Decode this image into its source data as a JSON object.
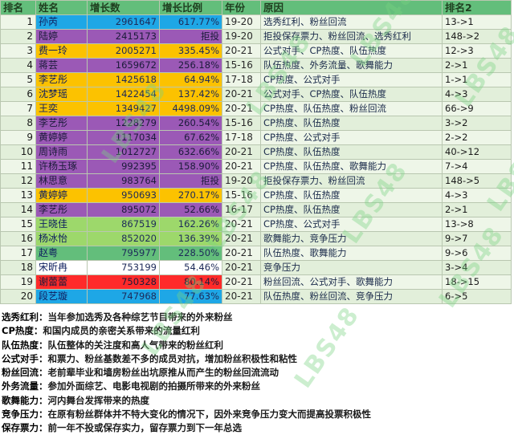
{
  "headers": {
    "rank": "排名",
    "name": "姓名",
    "growth": "增长数",
    "ratio": "增长比例",
    "year": "年份",
    "reason": "原因",
    "rank2": "排名2"
  },
  "rows": [
    {
      "rank": "1",
      "name": "孙芮",
      "growth": "2961647",
      "ratio": "617.77%",
      "year": "19-20",
      "reason": "选秀红利、粉丝回流",
      "rank2": "13->1",
      "color": "#1ea7e6"
    },
    {
      "rank": "2",
      "name": "陆婷",
      "growth": "2415173",
      "ratio": "拒投",
      "year": "19-20",
      "reason": "拒投保存票力、粉丝回流、选秀红利",
      "rank2": "148->2",
      "color": "#9b59b6"
    },
    {
      "rank": "3",
      "name": "费一玲",
      "growth": "2005271",
      "ratio": "335.45%",
      "year": "20-21",
      "reason": "公式对手、CP热度、队伍热度",
      "rank2": "12->3",
      "color": "#fcc200"
    },
    {
      "rank": "4",
      "name": "蒋芸",
      "growth": "1659672",
      "ratio": "256.18%",
      "year": "15-16",
      "reason": "队伍热度、外务流量、歌舞能力",
      "rank2": "2->1",
      "color": "#9b59b6"
    },
    {
      "rank": "5",
      "name": "李艺彤",
      "growth": "1425618",
      "ratio": "64.94%",
      "year": "17-18",
      "reason": "CP热度、公式对手",
      "rank2": "1->1",
      "color": "#fcc200"
    },
    {
      "rank": "6",
      "name": "沈梦瑶",
      "growth": "1422454",
      "ratio": "137.42%",
      "year": "20-21",
      "reason": "公式对手、CP热度、队伍热度",
      "rank2": "4->3",
      "color": "#fcc200"
    },
    {
      "rank": "7",
      "name": "王奕",
      "growth": "1349427",
      "ratio": "4498.09%",
      "year": "20-21",
      "reason": "CP热度、队伍热度、粉丝回流",
      "rank2": "66->9",
      "color": "#fcc200"
    },
    {
      "rank": "8",
      "name": "李艺彤",
      "growth": "1228279",
      "ratio": "260.54%",
      "year": "15-16",
      "reason": "CP热度、队伍热度",
      "rank2": "3->2",
      "color": "#9b59b6"
    },
    {
      "rank": "9",
      "name": "黄婷婷",
      "growth": "1117034",
      "ratio": "67.62%",
      "year": "17-18",
      "reason": "CP热度、公式对手",
      "rank2": "2->2",
      "color": "#9b59b6"
    },
    {
      "rank": "10",
      "name": "周诗雨",
      "growth": "1012727",
      "ratio": "632.66%",
      "year": "20-21",
      "reason": "CP热度、队伍热度",
      "rank2": "40->12",
      "color": "#9b59b6"
    },
    {
      "rank": "11",
      "name": "许杨玉琢",
      "growth": "992395",
      "ratio": "158.90%",
      "year": "20-21",
      "reason": "CP热度、队伍热度、歌舞能力",
      "rank2": "7->4",
      "color": "#9b59b6"
    },
    {
      "rank": "12",
      "name": "林思意",
      "growth": "983764",
      "ratio": "拒投",
      "year": "19-20",
      "reason": "拒投保存票力、粉丝回流",
      "rank2": "148->5",
      "color": "#9b59b6"
    },
    {
      "rank": "13",
      "name": "黄婷婷",
      "growth": "950693",
      "ratio": "270.17%",
      "year": "15-16",
      "reason": "CP热度、队伍热度",
      "rank2": "4->3",
      "color": "#fcc200"
    },
    {
      "rank": "14",
      "name": "李艺彤",
      "growth": "895072",
      "ratio": "52.66%",
      "year": "16-17",
      "reason": "CP热度、队伍热度",
      "rank2": "2->1",
      "color": "#9b59b6"
    },
    {
      "rank": "15",
      "name": "王晓佳",
      "growth": "867519",
      "ratio": "162.26%",
      "year": "20-21",
      "reason": "CP热度、公式对手",
      "rank2": "13->8",
      "color": "#9dd86b"
    },
    {
      "rank": "16",
      "name": "杨冰怡",
      "growth": "852020",
      "ratio": "136.39%",
      "year": "20-21",
      "reason": "歌舞能力、竞争压力",
      "rank2": "9->7",
      "color": "#9dd86b"
    },
    {
      "rank": "17",
      "name": "赵粤",
      "growth": "795977",
      "ratio": "228.50%",
      "year": "20-21",
      "reason": "队伍热度、歌舞能力",
      "rank2": "9->6",
      "color": "#63be7b"
    },
    {
      "rank": "18",
      "name": "宋昕冉",
      "growth": "753199",
      "ratio": "54.46%",
      "year": "20-21",
      "reason": "竞争压力",
      "rank2": "3->4",
      "color": "#ffffff"
    },
    {
      "rank": "19",
      "name": "谢蕾蕾",
      "growth": "750328",
      "ratio": "80.14%",
      "year": "20-21",
      "reason": "粉丝回流、公式对手、歌舞能力",
      "rank2": "18->15",
      "color": "#ff2a2a"
    },
    {
      "rank": "20",
      "name": "段艺璇",
      "growth": "747968",
      "ratio": "77.63%",
      "year": "20-21",
      "reason": "队伍热度、粉丝回流、竞争压力",
      "rank2": "6->5",
      "color": "#1ea7e6"
    }
  ],
  "notes": [
    {
      "term": "选秀红利：",
      "def": "当年参加选秀及各种综艺节目带来的外来粉丝"
    },
    {
      "term": "CP热度：",
      "def": "和国内成员的亲密关系带来的流量红利"
    },
    {
      "term": "队伍热度：",
      "def": "队伍整体的关注度和高人气带来的粉丝红利"
    },
    {
      "term": "公式对手：",
      "def": "和票力、粉丝基数差不多的成员对抗，增加粉丝积极性和粘性"
    },
    {
      "term": "粉丝回流：",
      "def": "老前辈毕业和墙房粉丝出坑原推从而产生的粉丝回流流动"
    },
    {
      "term": "外务流量：",
      "def": "参加外面综艺、电影电视剧的拍摄所带来的外来粉丝"
    },
    {
      "term": "歌舞能力：",
      "def": "河内舞台发挥带来的热度"
    },
    {
      "term": "竞争压力：",
      "def": "在原有粉丝群体并不特大变化的情况下，因外来竞争压力变大而提高投票积极性"
    },
    {
      "term": "保存票力：",
      "def": "前一年不投或保存实力，留存票力到下一年总选"
    }
  ],
  "watermark": "LBS48"
}
